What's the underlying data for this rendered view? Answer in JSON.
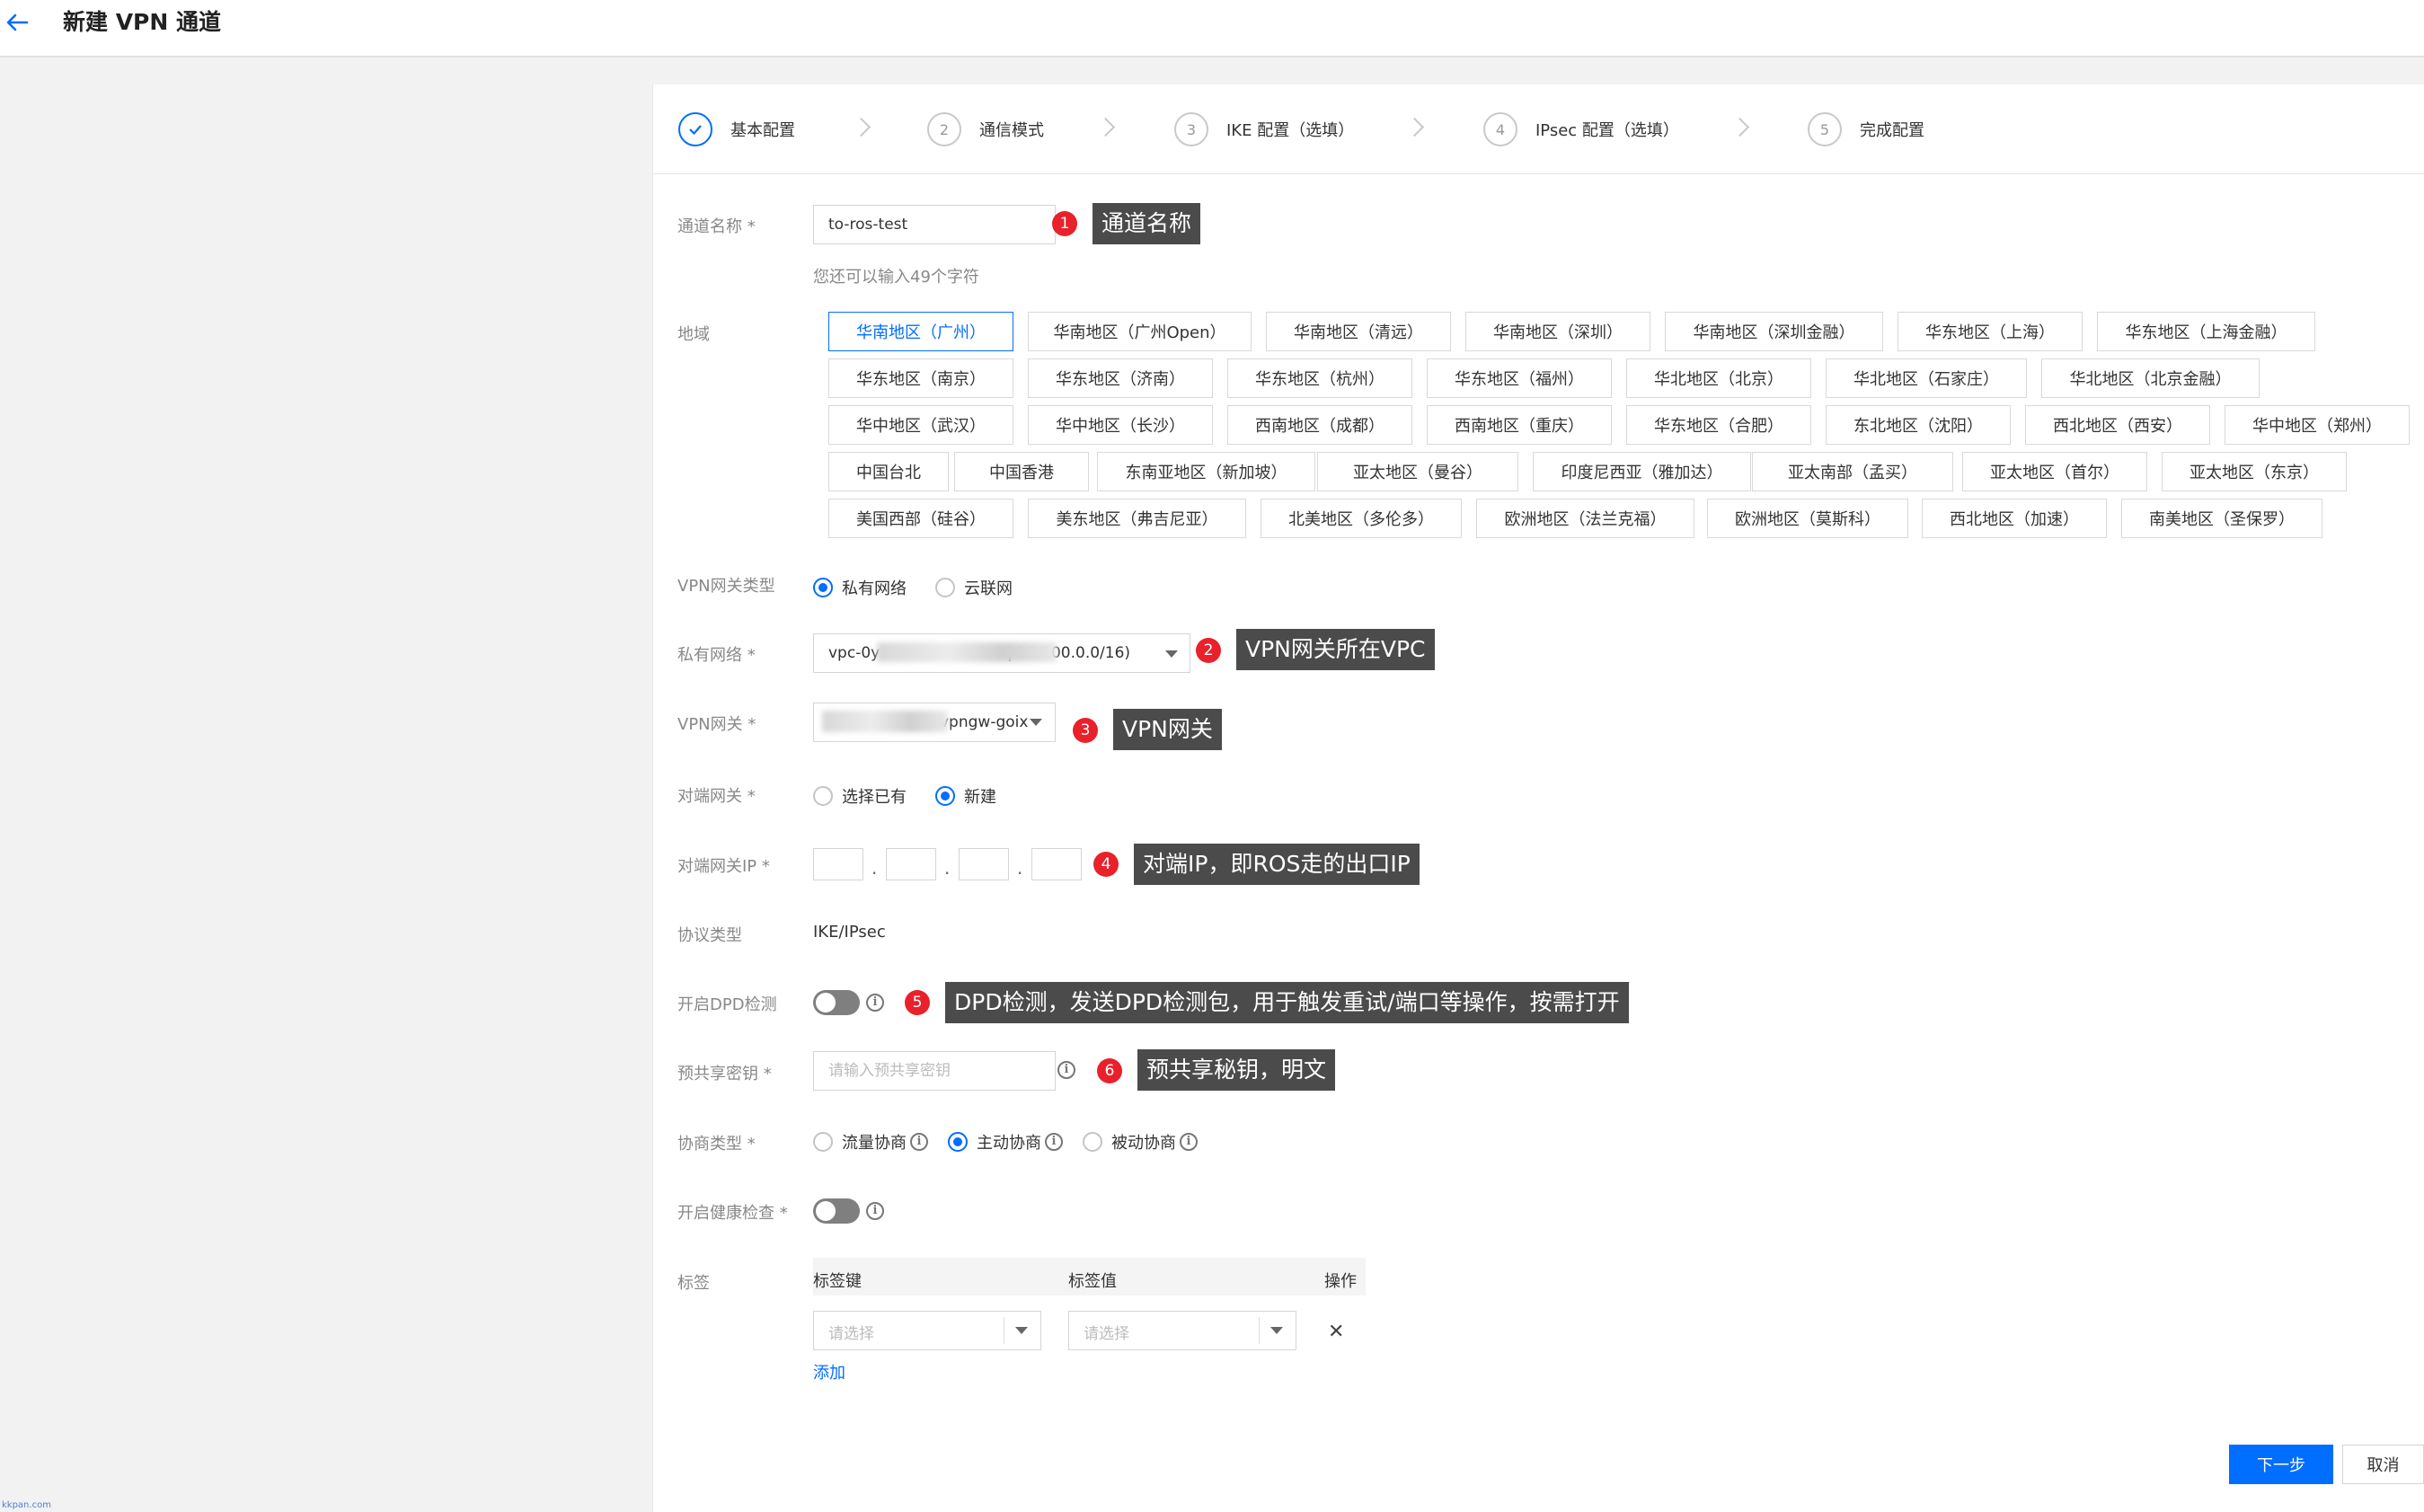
{
  "header": {
    "title": "新建 VPN 通道"
  },
  "steps": [
    {
      "num": "",
      "label": "基本配置",
      "done": true
    },
    {
      "num": "2",
      "label": "通信模式"
    },
    {
      "num": "3",
      "label": "IKE 配置（选填）"
    },
    {
      "num": "4",
      "label": "IPsec 配置（选填）"
    },
    {
      "num": "5",
      "label": "完成配置"
    }
  ],
  "form": {
    "channel_name": {
      "label": "通道名称",
      "value": "to-ros-test",
      "hint": "您还可以输入49个字符"
    },
    "region": {
      "label": "地域",
      "selected": "华南地区（广州）",
      "options": [
        [
          "华南地区（广州）",
          "华南地区（广州Open）",
          "华南地区（清远）",
          "华南地区（深圳）",
          "华南地区（深圳金融）",
          "华东地区（上海）",
          "华东地区（上海金融）"
        ],
        [
          "华东地区（南京）",
          "华东地区（济南）",
          "华东地区（杭州）",
          "华东地区（福州）",
          "华北地区（北京）",
          "华北地区（石家庄）",
          "华北地区（北京金融）"
        ],
        [
          "华中地区（武汉）",
          "华中地区（长沙）",
          "西南地区（成都）",
          "西南地区（重庆）",
          "华东地区（合肥）",
          "东北地区（沈阳）",
          "西北地区（西安）",
          "华中地区（郑州）"
        ],
        [
          "中国台北",
          "中国香港",
          "东南亚地区（新加坡）",
          "亚太地区（曼谷）",
          "印度尼西亚（雅加达）",
          "亚太南部（孟买）",
          "亚太地区（首尔）",
          "亚太地区（东京）"
        ],
        [
          "美国西部（硅谷）",
          "美东地区（弗吉尼亚）",
          "北美地区（多伦多）",
          "欧洲地区（法兰克福）",
          "欧洲地区（莫斯科）",
          "西北地区（加速）",
          "南美地区（圣保罗）"
        ]
      ]
    },
    "gateway_type": {
      "label": "VPN网关类型",
      "options": [
        "私有网络",
        "云联网"
      ],
      "selected": "私有网络"
    },
    "vpc": {
      "label": "私有网络",
      "prefix": "vpc-0y",
      "suffix": "| 10.100.0.0/16)"
    },
    "vpn_gateway": {
      "label": "VPN网关",
      "suffix": "vpngw-goix"
    },
    "peer_gateway": {
      "label": "对端网关",
      "options": [
        "选择已有",
        "新建"
      ],
      "selected": "新建"
    },
    "peer_ip": {
      "label": "对端网关IP",
      "dot": "."
    },
    "protocol": {
      "label": "协议类型",
      "value": "IKE/IPsec"
    },
    "dpd": {
      "label": "开启DPD检测",
      "enabled": false
    },
    "psk": {
      "label": "预共享密钥",
      "placeholder": "请输入预共享密钥"
    },
    "negotiation": {
      "label": "协商类型",
      "options": [
        "流量协商",
        "主动协商",
        "被动协商"
      ],
      "selected": "主动协商"
    },
    "health_check": {
      "label": "开启健康检查",
      "enabled": false
    },
    "tags": {
      "label": "标签",
      "headers": [
        "标签键",
        "标签值",
        "操作"
      ],
      "key_placeholder": "请选择",
      "value_placeholder": "请选择",
      "add_label": "添加"
    },
    "required_mark": "*",
    "info_glyph": "i"
  },
  "annotations": [
    {
      "num": "1",
      "text": "通道名称"
    },
    {
      "num": "2",
      "text": "VPN网关所在VPC"
    },
    {
      "num": "3",
      "text": "VPN网关"
    },
    {
      "num": "4",
      "text": "对端IP，即ROS走的出口IP"
    },
    {
      "num": "5",
      "text": "DPD检测，发送DPD检测包，用于触发重试/端口等操作，按需打开"
    },
    {
      "num": "6",
      "text": "预共享秘钥，明文"
    }
  ],
  "footer": {
    "next_label": "下一步",
    "cancel_label": "取消"
  },
  "watermark": "kkpan.com",
  "colors": {
    "accent": "#006eff",
    "badge": "#e8212b",
    "annotation_bg": "#4b4b4b"
  }
}
